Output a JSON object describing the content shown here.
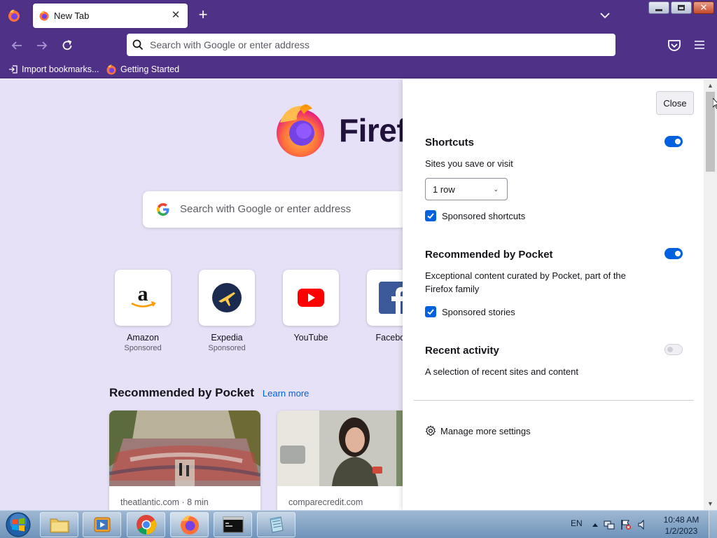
{
  "browser": {
    "tab": {
      "title": "New Tab",
      "close_glyph": "✕"
    },
    "new_tab_glyph": "+",
    "urlbar": {
      "placeholder": "Search with Google or enter address"
    },
    "bookmarks": [
      {
        "label": "Import bookmarks...",
        "icon": "import-icon"
      },
      {
        "label": "Getting Started",
        "icon": "firefox-icon"
      }
    ]
  },
  "newtab": {
    "brand_word": "Firefox",
    "search_placeholder": "Search with Google or enter address",
    "shortcuts": [
      {
        "title": "Amazon",
        "sub": "Sponsored"
      },
      {
        "title": "Expedia",
        "sub": "Sponsored"
      },
      {
        "title": "YouTube",
        "sub": ""
      },
      {
        "title": "Facebook",
        "sub": ""
      }
    ],
    "pocket": {
      "title": "Recommended by Pocket",
      "learn_more": "Learn more",
      "cards": [
        {
          "source": "theatlantic.com · 8 min"
        },
        {
          "source": "comparecredit.com"
        }
      ]
    }
  },
  "customize": {
    "close_label": "Close",
    "shortcuts": {
      "title": "Shortcuts",
      "desc": "Sites you save or visit",
      "enabled": true,
      "rows_value": "1 row",
      "sponsored_label": "Sponsored shortcuts",
      "sponsored_checked": true
    },
    "pocket": {
      "title": "Recommended by Pocket",
      "desc": "Exceptional content curated by Pocket, part of the Firefox family",
      "enabled": true,
      "sponsored_label": "Sponsored stories",
      "sponsored_checked": true
    },
    "recent": {
      "title": "Recent activity",
      "desc": "A selection of recent sites and content",
      "enabled": false
    },
    "manage_label": "Manage more settings"
  },
  "taskbar": {
    "language": "EN",
    "time": "10:48 AM",
    "date": "1/2/2023"
  },
  "colors": {
    "chrome": "#4f3188",
    "newtab_bg": "#e7e1f7",
    "accent": "#0061e0"
  }
}
